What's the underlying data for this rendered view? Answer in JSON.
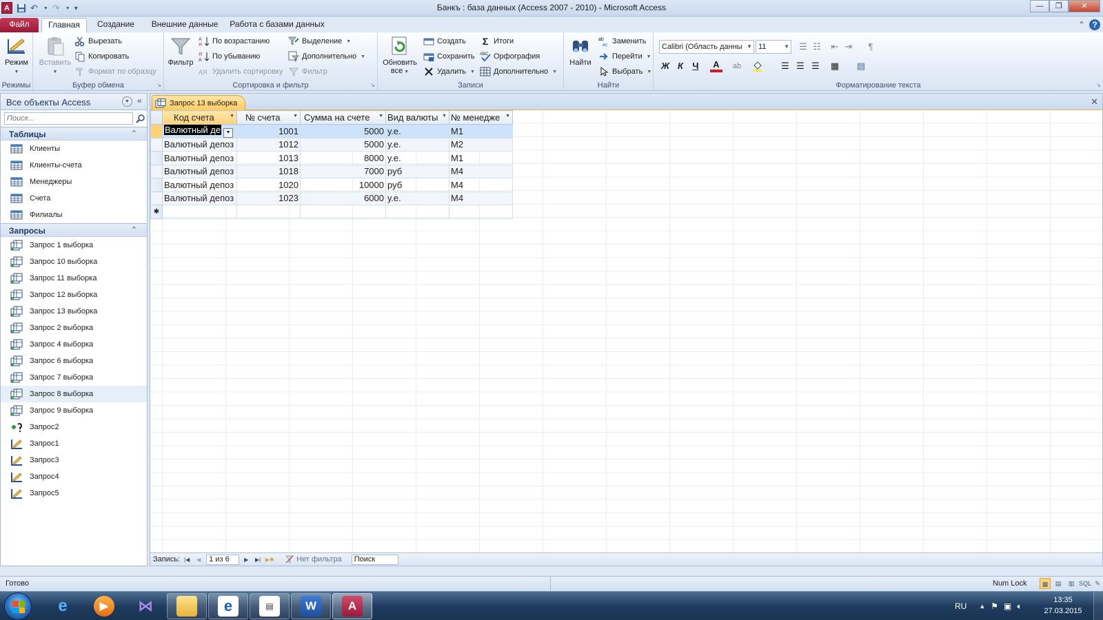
{
  "window": {
    "title": "Банкъ : база данных (Access 2007 - 2010)  -  Microsoft Access",
    "app_icon_letter": "A",
    "minimize": "—",
    "restore": "❐",
    "close": "✕"
  },
  "ribbon_tabs": [
    {
      "label": "Файл"
    },
    {
      "label": "Главная"
    },
    {
      "label": "Создание"
    },
    {
      "label": "Внешние данные"
    },
    {
      "label": "Работа с базами данных"
    }
  ],
  "ribbon": {
    "groups": {
      "views": "Режимы",
      "clipboard": "Буфер обмена",
      "sort_filter": "Сортировка и фильтр",
      "records": "Записи",
      "find": "Найти",
      "text_format": "Форматирование текста"
    },
    "view_btn": "Режим",
    "paste_btn": "Вставить",
    "cut_btn": "Вырезать",
    "copy_btn": "Копировать",
    "format_painter_btn": "Формат по образцу",
    "filter_btn": "Фильтр",
    "sort_asc_btn": "По возрастанию",
    "sort_desc_btn": "По убыванию",
    "remove_sort_btn": "Удалить сортировку",
    "selection_btn": "Выделение",
    "advanced_filter_btn": "Дополнительно",
    "toggle_filter_btn": "Фильтр",
    "refresh_btn_line1": "Обновить",
    "refresh_btn_line2": "все",
    "new_btn": "Создать",
    "save_btn": "Сохранить",
    "delete_btn": "Удалить",
    "totals_btn": "Итоги",
    "spelling_btn": "Орфография",
    "more_btn": "Дополнительно",
    "find_btn": "Найти",
    "replace_btn": "Заменить",
    "goto_btn": "Перейти",
    "select_btn": "Выбрать",
    "font_name": "Calibri (Область данны",
    "font_size": "11",
    "bold": "Ж",
    "italic": "К",
    "underline": "Ч",
    "font_color_letter": "A"
  },
  "nav_pane": {
    "title": "Все объекты Access",
    "search_placeholder": "Поиск...",
    "sections": [
      {
        "title": "Таблицы",
        "items": [
          "Клиенты",
          "Клиенты-счета",
          "Менеджеры",
          "Счета",
          "Филиалы"
        ]
      },
      {
        "title": "Запросы",
        "items": [
          "Запрос 1 выборка",
          "Запрос 10 выборка",
          "Запрос 11 выборка",
          "Запрос 12 выборка",
          "Запрос 13 выборка",
          "Запрос 2 выборка",
          "Запрос 4 выборка",
          "Запрос 6 выборка",
          "Запрос 7 выборка",
          "Запрос 8 выборка",
          "Запрос 9 выборка",
          "Запрос2",
          "Запрос1",
          "Запрос3",
          "Запрос4",
          "Запрос5"
        ]
      }
    ]
  },
  "document": {
    "tab_title": "Запрос 13 выборка",
    "columns": [
      "Код счета",
      "№ счета",
      "Сумма на счете",
      "Вид валюты",
      "№ менедже"
    ],
    "rows": [
      [
        "Валютный де",
        "1001",
        "5000",
        "у.е.",
        "М1"
      ],
      [
        "Валютный депоз",
        "1012",
        "5000",
        "у.е.",
        "М2"
      ],
      [
        "Валютный депоз",
        "1013",
        "8000",
        "у.е.",
        "М1"
      ],
      [
        "Валютный депоз",
        "1018",
        "7000",
        "руб",
        "М4"
      ],
      [
        "Валютный депоз",
        "1020",
        "10000",
        "руб",
        "М4"
      ],
      [
        "Валютный депоз",
        "1023",
        "6000",
        "у.е.",
        "М4"
      ]
    ],
    "new_row_marker": "✱"
  },
  "record_nav": {
    "label": "Запись:",
    "position": "1 из 6",
    "filter_status": "Нет фильтра",
    "search": "Поиск"
  },
  "status": {
    "left": "Готово",
    "numlock": "Num Lock"
  },
  "taskbar": {
    "lang": "RU",
    "time": "13:35",
    "date": "27.03.2015"
  }
}
